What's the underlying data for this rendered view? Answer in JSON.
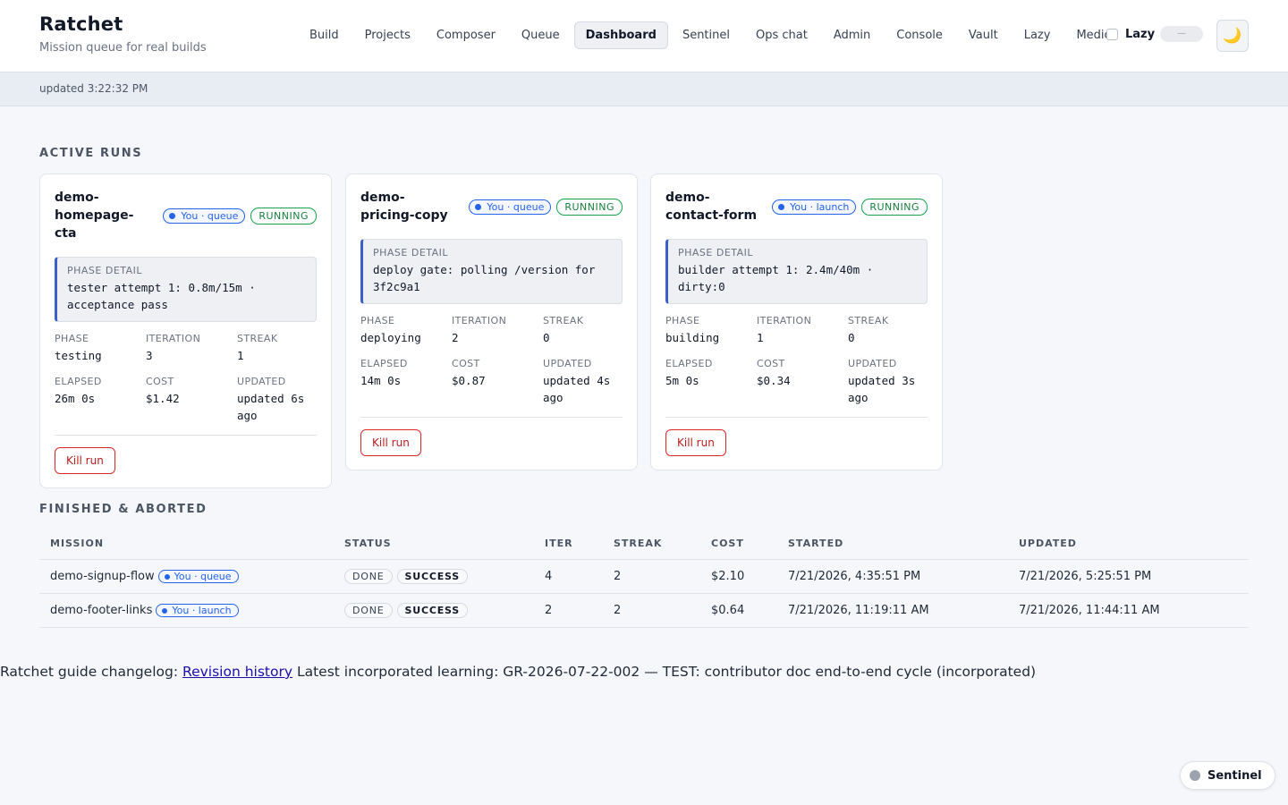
{
  "app": {
    "title": "Ratchet",
    "subtitle": "Mission queue for real builds"
  },
  "nav": [
    {
      "label": "Build",
      "active": false
    },
    {
      "label": "Projects",
      "active": false
    },
    {
      "label": "Composer",
      "active": false
    },
    {
      "label": "Queue",
      "active": false
    },
    {
      "label": "Dashboard",
      "active": true
    },
    {
      "label": "Sentinel",
      "active": false
    },
    {
      "label": "Ops chat",
      "active": false
    },
    {
      "label": "Admin",
      "active": false
    },
    {
      "label": "Console",
      "active": false
    },
    {
      "label": "Vault",
      "active": false
    },
    {
      "label": "Lazy",
      "active": false
    },
    {
      "label": "Medic",
      "active": false
    }
  ],
  "lazy": {
    "label": "Lazy",
    "checked": false,
    "pill": "—"
  },
  "theme_icon": "moon-icon",
  "updated": "updated 3:22:32 PM",
  "active_title": "ACTIVE RUNS",
  "stat_labels": {
    "phase": "PHASE",
    "iteration": "ITERATION",
    "streak": "STREAK",
    "elapsed": "ELAPSED",
    "cost": "COST",
    "updated": "UPDATED"
  },
  "phase_detail_label": "PHASE DETAIL",
  "kill_label": "Kill run",
  "cards": [
    {
      "name": "demo-homepage-cta",
      "owner": "You · queue",
      "status": "RUNNING",
      "phase_detail": "tester attempt 1: 0.8m/15m · acceptance pass",
      "phase": "testing",
      "iteration": "3",
      "streak": "1",
      "elapsed": "26m 0s",
      "cost": "$1.42",
      "updated": "updated 6s ago"
    },
    {
      "name": "demo-pricing-copy",
      "owner": "You · queue",
      "status": "RUNNING",
      "phase_detail": "deploy gate: polling /version for 3f2c9a1",
      "phase": "deploying",
      "iteration": "2",
      "streak": "0",
      "elapsed": "14m 0s",
      "cost": "$0.87",
      "updated": "updated 4s ago"
    },
    {
      "name": "demo-contact-form",
      "owner": "You · launch",
      "status": "RUNNING",
      "phase_detail": "builder attempt 1: 2.4m/40m · dirty:0",
      "phase": "building",
      "iteration": "1",
      "streak": "0",
      "elapsed": "5m 0s",
      "cost": "$0.34",
      "updated": "updated 3s ago"
    }
  ],
  "finished_title": "FINISHED & ABORTED",
  "table": {
    "headers": [
      "MISSION",
      "STATUS",
      "ITER",
      "STREAK",
      "COST",
      "STARTED",
      "UPDATED"
    ],
    "rows": [
      {
        "mission": "demo-signup-flow",
        "owner": "You · queue",
        "state": "DONE",
        "result": "SUCCESS",
        "iter": "4",
        "streak": "2",
        "cost": "$2.10",
        "started": "7/21/2026, 4:35:51 PM",
        "updated": "7/21/2026, 5:25:51 PM"
      },
      {
        "mission": "demo-footer-links",
        "owner": "You · launch",
        "state": "DONE",
        "result": "SUCCESS",
        "iter": "2",
        "streak": "2",
        "cost": "$0.64",
        "started": "7/21/2026, 11:19:11 AM",
        "updated": "7/21/2026, 11:44:11 AM"
      }
    ]
  },
  "changelog": {
    "prefix": "Ratchet guide changelog:",
    "link": "Revision history",
    "suffix": "Latest incorporated learning: GR-2026-07-22-002 — TEST: contributor doc end-to-end cycle (incorporated)"
  },
  "sentinel_chip": "Sentinel",
  "colors": {
    "accent": "#2563eb",
    "running": "#16a34a",
    "danger": "#dc2626",
    "phase_border": "#3b5fc9"
  }
}
